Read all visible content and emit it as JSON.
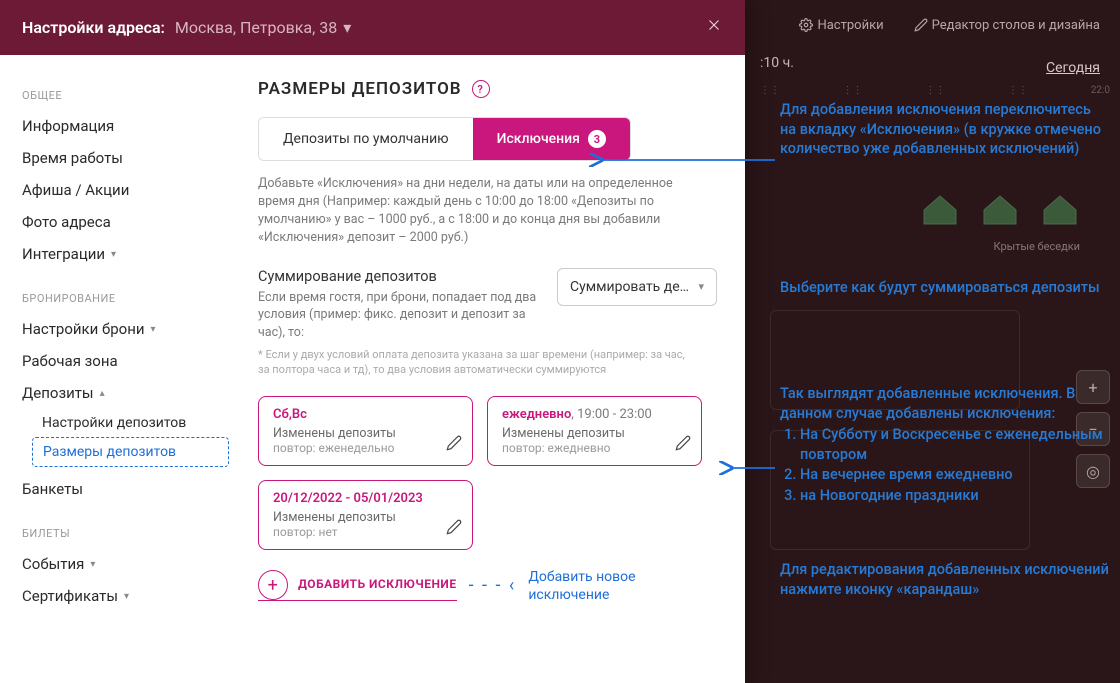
{
  "backdrop": {
    "nav": {
      "settings": "Настройки",
      "editor": "Редактор столов и дизайна"
    },
    "time": ":10 ч.",
    "today": "Сегодня",
    "ticks": [
      "",
      "",
      "",
      "",
      "22:0"
    ],
    "label_besedki": "Крытые беседки"
  },
  "header": {
    "label": "Настройки адреса:",
    "address": "Москва, Петровка, 38"
  },
  "sidebar": {
    "s1": "ОБЩЕЕ",
    "items1": [
      "Информация",
      "Время работы",
      "Афиша / Акции",
      "Фото адреса",
      "Интеграции"
    ],
    "s2": "БРОНИРОВАНИЕ",
    "items2": [
      "Настройки брони",
      "Рабочая зона",
      "Депозиты"
    ],
    "deposits_sub": [
      "Настройки депозитов",
      "Размеры депозитов"
    ],
    "bankets": "Банкеты",
    "s3": "БИЛЕТЫ",
    "items3": [
      "События",
      "Сертификаты"
    ]
  },
  "content": {
    "title": "РАЗМЕРЫ ДЕПОЗИТОВ",
    "tab_default": "Депозиты по умолчанию",
    "tab_exc": "Исключения",
    "exc_count": "3",
    "hint": "Добавьте «Исключения» на дни недели, на даты или на определенное время дня (Например: каждый день с 10:00 до 18:00 «Депозиты по умолчанию» у вас – 1000 руб., а с 18:00 и до конца дня вы добавили «Исключения» депозит – 2000 руб.)",
    "sum_title": "Суммирование депозитов",
    "sum_desc": "Если время гостя, при брони, попадает под два условия (пример: фикс. депозит и депозит за час), то:",
    "sum_select": "Суммировать де…",
    "sum_foot": "* Если у двух условий оплата депозита указана за шаг времени (например: за час, за полтора часа и тд), то два условия автоматически суммируются",
    "cards": [
      {
        "title": "Сб,Вс",
        "time": "",
        "line": "Изменены депозиты",
        "meta": "повтор: еженедельно"
      },
      {
        "title": "ежедневно",
        "time": ", 19:00 - 23:00",
        "line": "Изменены депозиты",
        "meta": "повтор: ежедневно"
      },
      {
        "title": "20/12/2022 - 05/01/2023",
        "time": "",
        "line": "Изменены депозиты",
        "meta": "повтор: нет"
      }
    ],
    "add_label": "ДОБАВИТЬ ИСКЛЮЧЕНИЕ",
    "add_hint_1": "Добавить новое",
    "add_hint_2": "исключение"
  },
  "callouts": {
    "c1": "Для добавления исключения переключитесь на вкладку «Исключения» (в кружке отмечено количество уже добавленных исключений)",
    "c2": "Выберите как будут суммироваться депозиты",
    "c3_head": "Так выглядят добавленные исключения. В данном случае добавлены исключения:",
    "c3_items": [
      "На Субботу и Воскресенье с еженедельным повтором",
      "На вечернее время ежедневно",
      "на Новогодние праздники"
    ],
    "c4": "Для редактирования добавленных исключений нажмите иконку «карандаш»"
  }
}
